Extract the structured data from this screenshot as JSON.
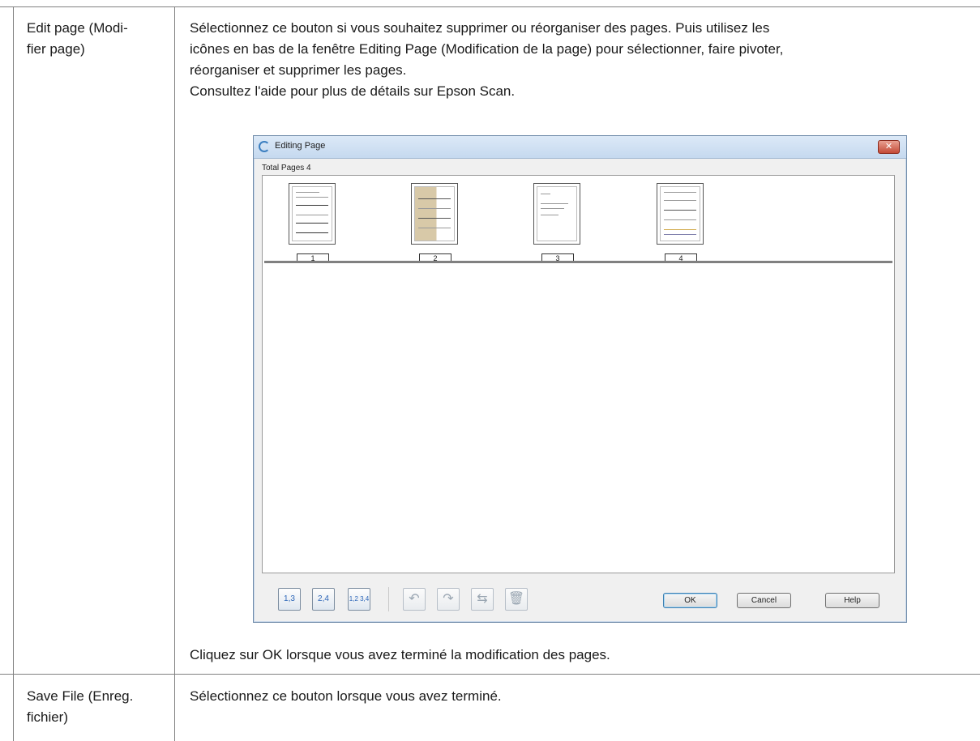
{
  "rows": [
    {
      "label": "Edit page (Modi-\nfier page)",
      "label_lines": [
        "Edit page (Modi-",
        "fier page)"
      ],
      "description_lines": [
        "Sélectionnez ce bouton si vous souhaitez supprimer ou réorganiser des pages. Puis utilisez les",
        "icônes en bas de la fenêtre Editing Page (Modification de la page) pour sélectionner, faire pivoter,",
        "réorganiser et supprimer les pages.",
        "Consultez l'aide pour plus de détails sur Epson Scan."
      ],
      "after_text": "Cliquez sur OK lorsque vous avez terminé la modification des pages."
    },
    {
      "label_lines": [
        "Save File (Enreg.",
        "fichier)"
      ],
      "description": "Sélectionnez ce bouton lorsque vous avez terminé."
    }
  ],
  "dialog": {
    "title": "Editing Page",
    "close_label": "✕",
    "total_pages": "Total Pages 4",
    "thumbnails": [
      {
        "number": "1"
      },
      {
        "number": "2"
      },
      {
        "number": "3"
      },
      {
        "number": "4"
      }
    ],
    "tools": [
      {
        "name": "select-odd-pages",
        "label": "1,3"
      },
      {
        "name": "select-even-pages",
        "label": "2,4"
      },
      {
        "name": "select-all-pages",
        "label": "1,2 3,4"
      },
      {
        "name": "rotate-left",
        "glyph": "↶"
      },
      {
        "name": "rotate-right",
        "glyph": "↷"
      },
      {
        "name": "reorder",
        "glyph": "⇆"
      },
      {
        "name": "delete",
        "glyph": "🗑"
      }
    ],
    "buttons": {
      "ok": "OK",
      "cancel": "Cancel",
      "help": "Help"
    }
  },
  "colors": {
    "border": "#808080",
    "title_bar": "#c5d9ef",
    "close_button": "#c44a36",
    "icon_blue": "#2d66b8"
  }
}
